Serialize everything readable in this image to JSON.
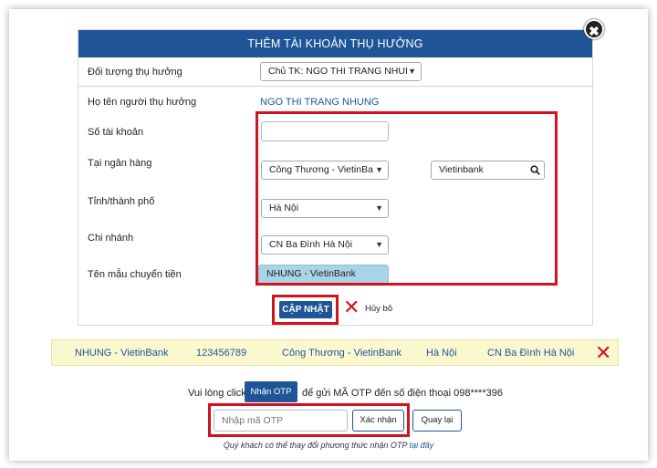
{
  "modal": {
    "title": "THÊM TÀI KHOẢN THỤ HƯỞNG",
    "close_icon": "✖"
  },
  "form": {
    "beneficiary_type_label": "Đối tượng thụ hưởng",
    "beneficiary_type_value": "Chủ TK: NGO THI TRANG NHUI",
    "beneficiary_name_label": "Họ tên người thụ hưởng",
    "beneficiary_name_value": "NGO THI TRANG NHUNG",
    "account_number_label": "Số tài khoản",
    "account_number_value": "",
    "bank_label": "Tại ngân hàng",
    "bank_value": "Công Thương - VietinBa",
    "bank_search_value": "Vietinbank",
    "province_label": "Tỉnh/thành phố",
    "province_value": "Hà Nội",
    "branch_label": "Chi nhánh",
    "branch_value": "CN Ba Đình Hà Nội",
    "template_label": "Tên mẫu chuyển tiền",
    "template_value": "NHUNG - VietinBank",
    "update_button": "CẬP NHẬT",
    "cancel_label": "Hủy bỏ"
  },
  "saved_row": {
    "template": "NHUNG - VietinBank",
    "account": "123456789",
    "bank": "Công Thương - VietinBank",
    "province": "Hà Nội",
    "branch": "CN Ba Đình Hà Nội"
  },
  "otp": {
    "prompt_before": "Vui lòng click",
    "get_otp_button": "Nhận OTP",
    "prompt_after": "để gửi MÃ OTP đến số điện thoại 098****396",
    "otp_placeholder": "Nhập mã OTP",
    "confirm_button": "Xác nhận",
    "back_button": "Quay lại",
    "note_text": "Quý khách có thể thay đổi phương thức nhận OTP",
    "note_link": "tại đây"
  },
  "colors": {
    "header_blue": "#1f5597",
    "highlight_red": "#d4121e",
    "saved_row_bg": "#fbf8cf",
    "template_field_bg": "#a9d4e6"
  }
}
